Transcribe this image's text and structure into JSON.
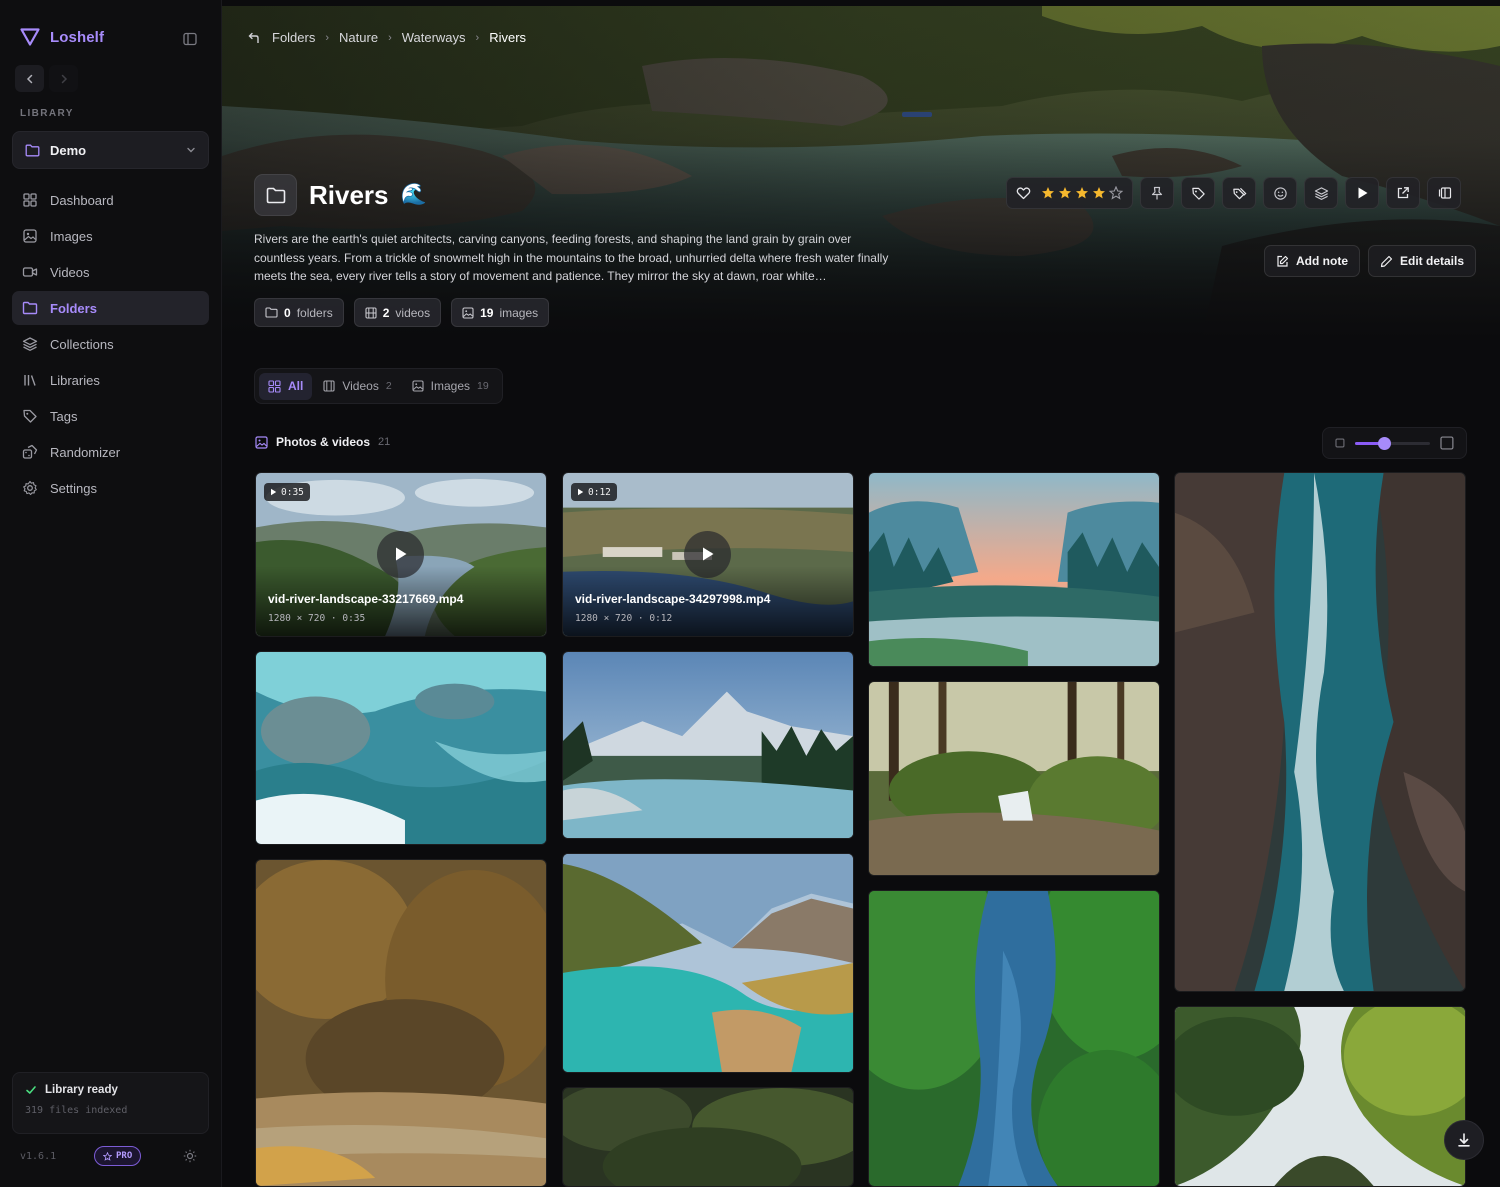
{
  "app": {
    "name": "Loshelf",
    "accent": "#a78bfa"
  },
  "sidebar": {
    "library_label": "LIBRARY",
    "library_selected": "Demo",
    "items": [
      {
        "label": "Dashboard",
        "icon": "dashboard-icon",
        "active": false
      },
      {
        "label": "Images",
        "icon": "image-icon",
        "active": false
      },
      {
        "label": "Videos",
        "icon": "video-icon",
        "active": false
      },
      {
        "label": "Folders",
        "icon": "folder-icon",
        "active": true
      },
      {
        "label": "Collections",
        "icon": "layers-icon",
        "active": false
      },
      {
        "label": "Libraries",
        "icon": "library-icon",
        "active": false
      },
      {
        "label": "Tags",
        "icon": "tag-icon",
        "active": false
      },
      {
        "label": "Randomizer",
        "icon": "dice-icon",
        "active": false
      },
      {
        "label": "Settings",
        "icon": "gear-icon",
        "active": false
      }
    ],
    "status": {
      "title": "Library ready",
      "sub": "319 files indexed"
    },
    "version": "v1.6.1",
    "pro_label": "PRO"
  },
  "breadcrumb": [
    "Folders",
    "Nature",
    "Waterways",
    "Rivers"
  ],
  "header": {
    "title": "Rivers",
    "emoji": "🌊",
    "description": "Rivers are the earth's quiet architects, carving canyons, feeding forests, and shaping the land grain by grain over countless years. From a trickle of snowmelt high in the mountains to the broad, unhurried delta where fresh water finally meets the sea, every river tells a story of movement and patience. They mirror the sky at dawn, roar white…",
    "counts": [
      {
        "value": "0",
        "label": "folders",
        "icon": "folder-icon"
      },
      {
        "value": "2",
        "label": "videos",
        "icon": "film-icon"
      },
      {
        "value": "19",
        "label": "images",
        "icon": "image-icon"
      }
    ],
    "rating": 4,
    "rating_max": 5,
    "toolbar_icons": [
      "heart-icon",
      "pin-icon",
      "tag-icon",
      "tags-icon",
      "smile-icon",
      "layers-icon",
      "play-icon",
      "external-link-icon",
      "panel-icon"
    ],
    "add_note_label": "Add note",
    "edit_details_label": "Edit details"
  },
  "filters": {
    "tabs": [
      {
        "label": "All",
        "count": "",
        "active": true
      },
      {
        "label": "Videos",
        "count": "2",
        "active": false
      },
      {
        "label": "Images",
        "count": "19",
        "active": false
      }
    ]
  },
  "section": {
    "title": "Photos & videos",
    "count": "21",
    "thumb_size_fraction": 0.38
  },
  "videos": [
    {
      "duration": "0:35",
      "name": "vid-river-landscape-33217669.mp4",
      "meta": "1280 × 720 · 0:35"
    },
    {
      "duration": "0:12",
      "name": "vid-river-landscape-34297998.mp4",
      "meta": "1280 × 720 · 0:12"
    }
  ]
}
